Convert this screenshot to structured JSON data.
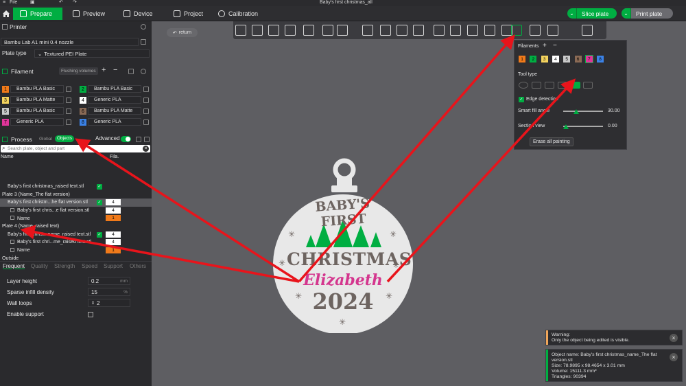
{
  "titlebar": {
    "file_menu": "File",
    "doc_title": "Baby's first christmas_all"
  },
  "tabs": [
    {
      "label": "Prepare"
    },
    {
      "label": "Preview"
    },
    {
      "label": "Device"
    },
    {
      "label": "Project"
    },
    {
      "label": "Calibration"
    }
  ],
  "actions": {
    "slice": "Slice plate",
    "print": "Print plate"
  },
  "printer": {
    "header": "Printer",
    "model": "Bambu Lab A1 mini 0.4 nozzle",
    "plate_type_label": "Plate type",
    "plate_type": "Textured PEI Plate"
  },
  "filament": {
    "header": "Filament",
    "flushing_volumes": "Flushing volumes",
    "items": [
      {
        "num": "1",
        "name": "Bambu PLA Basic",
        "color": "#f07a1a"
      },
      {
        "num": "2",
        "name": "Bambu PLA Basic",
        "color": "#00ae42"
      },
      {
        "num": "3",
        "name": "Bambu PLA Matte",
        "color": "#f4d35e"
      },
      {
        "num": "4",
        "name": "Generic PLA",
        "color": "#ffffff"
      },
      {
        "num": "5",
        "name": "Bambu PLA Basic",
        "color": "#c9c9c9"
      },
      {
        "num": "6",
        "name": "Bambu PLA Matte",
        "color": "#8a6a55"
      },
      {
        "num": "7",
        "name": "Generic PLA",
        "color": "#e0359a"
      },
      {
        "num": "8",
        "name": "Generic PLA",
        "color": "#3b82e6"
      }
    ]
  },
  "process": {
    "header": "Process",
    "global": "Global",
    "objects": "Objects",
    "advanced": "Advanced",
    "search_placeholder": "Search plate, object and part",
    "col_name": "Name",
    "col_fila": "Fila."
  },
  "tree": [
    {
      "label": "Baby's first christmas_raised text.stl",
      "fila": "",
      "indent": 1,
      "chk": true
    },
    {
      "label": "Plate 3 (Name_The flat version)",
      "fila": "",
      "indent": 0,
      "chk": false
    },
    {
      "label": "Baby's first christm...he flat version.stl",
      "fila": "4",
      "indent": 1,
      "chk": true,
      "sel": true
    },
    {
      "label": "Baby's first chris...e flat version.stl",
      "fila": "4",
      "indent": 2,
      "chk": false
    },
    {
      "label": "Name",
      "fila": "1",
      "indent": 2,
      "chk": false,
      "orange": true
    },
    {
      "label": "Plate 4 (Name_raised text)",
      "fila": "",
      "indent": 0,
      "chk": false
    },
    {
      "label": "Baby's first christ...name_raised text.stl",
      "fila": "4",
      "indent": 1,
      "chk": true
    },
    {
      "label": "Baby's first chri...me_raised text.stl",
      "fila": "4",
      "indent": 2,
      "chk": false
    },
    {
      "label": "Name",
      "fila": "1",
      "indent": 2,
      "chk": false,
      "orange": true
    },
    {
      "label": "Outside",
      "fila": "",
      "indent": 0,
      "chk": false
    }
  ],
  "param_tabs": [
    "Frequent",
    "Quality",
    "Strength",
    "Speed",
    "Support",
    "Others"
  ],
  "params": [
    {
      "label": "Layer height",
      "value": "0.2",
      "unit": "mm"
    },
    {
      "label": "Sparse infill density",
      "value": "15",
      "unit": "%"
    },
    {
      "label": "Wall loops",
      "value": "2",
      "unit": ""
    },
    {
      "label": "Enable support",
      "value": "",
      "unit": ""
    }
  ],
  "canvas": {
    "return": "return"
  },
  "paint": {
    "filaments_label": "Filaments",
    "swatches": [
      {
        "num": "1",
        "color": "#f07a1a"
      },
      {
        "num": "2",
        "color": "#00ae42"
      },
      {
        "num": "3",
        "color": "#f4d35e"
      },
      {
        "num": "4",
        "color": "#ffffff"
      },
      {
        "num": "5",
        "color": "#c9c9c9"
      },
      {
        "num": "6",
        "color": "#8a6a55"
      },
      {
        "num": "7",
        "color": "#e0359a"
      },
      {
        "num": "8",
        "color": "#3b82e6"
      }
    ],
    "tool_type": "Tool type",
    "edge_detection": "Edge detection",
    "smart_fill_angle": "Smart fill angle",
    "smart_fill_value": "30.00",
    "section_view": "Section view",
    "section_value": "0.00",
    "erase_all": "Erase all painting"
  },
  "ornament": {
    "line1": "BABY'S FIRST",
    "line2": "CHRISTMAS",
    "name": "Elizabeth",
    "year": "2024"
  },
  "notifications": {
    "warning_title": "Warning:",
    "warning_text": "Only the object being edited is visible.",
    "info_line1": "Object name: Baby's first christmas_name_The flat",
    "info_line2": "version.stl",
    "info_size": "Size: 78.9895 x 98.4654 x 3.01 mm",
    "info_volume": "Volume: 15111.3 mm³",
    "info_triangles": "Triangles: 90394"
  },
  "colors": {
    "accent": "#00ae42",
    "annotation_arrow": "#e8141b"
  }
}
